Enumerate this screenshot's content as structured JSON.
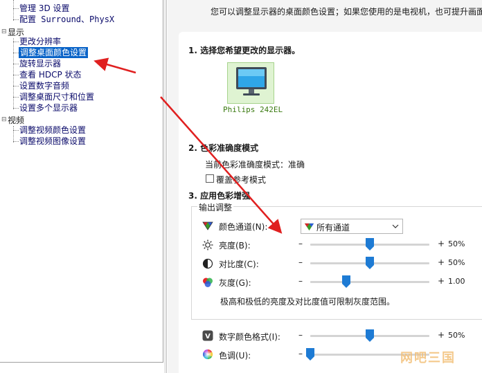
{
  "tree": {
    "manage_3d": "管理 3D 设置",
    "configure_surround": "配置 Surround、PhysX",
    "display_group": "显示",
    "display_items": [
      "更改分辨率",
      "调整桌面颜色设置",
      "旋转显示器",
      "查看 HDCP 状态",
      "设置数字音频",
      "调整桌面尺寸和位置",
      "设置多个显示器"
    ],
    "video_group": "视频",
    "video_items": [
      "调整视频颜色设置",
      "调整视频图像设置"
    ]
  },
  "content": {
    "intro": "您可以调整显示器的桌面颜色设置；如果您使用的是电视机，也可提升画面",
    "section1_title": "1. 选择您希望更改的显示器。",
    "monitor_name": "Philips 242EL",
    "section2_title": "2. 色彩准确度模式",
    "current_mode_label": "当前色彩准确度模式：准确",
    "override_label": "覆盖参考模式",
    "section3_title": "3. 应用色彩增强",
    "output_group": "输出调整",
    "channel_label": "颜色通道(N):",
    "channel_value": "所有通道",
    "brightness_label": "亮度(B):",
    "brightness_value": "50%",
    "brightness_level": 50,
    "contrast_label": "对比度(C):",
    "contrast_value": "50%",
    "contrast_level": 50,
    "gamma_label": "灰度(G):",
    "gamma_value": "1.00",
    "gamma_level": 30,
    "hint": "极高和极低的亮度及对比度值可限制灰度范围。",
    "digital_vibrance_label": "数字颜色格式(I):",
    "digital_vibrance_value": "50%",
    "digital_vibrance_level": 50,
    "hue_label": "色调(U):",
    "hue_level": 0,
    "minus_sign": "–",
    "plus_sign": "+"
  },
  "watermark": "网吧三国",
  "colors": {
    "selection": "#0a64c8",
    "slider_thumb": "#1e7bd4",
    "arrow": "#e02020",
    "monitor_tile": "#dff3d2"
  }
}
